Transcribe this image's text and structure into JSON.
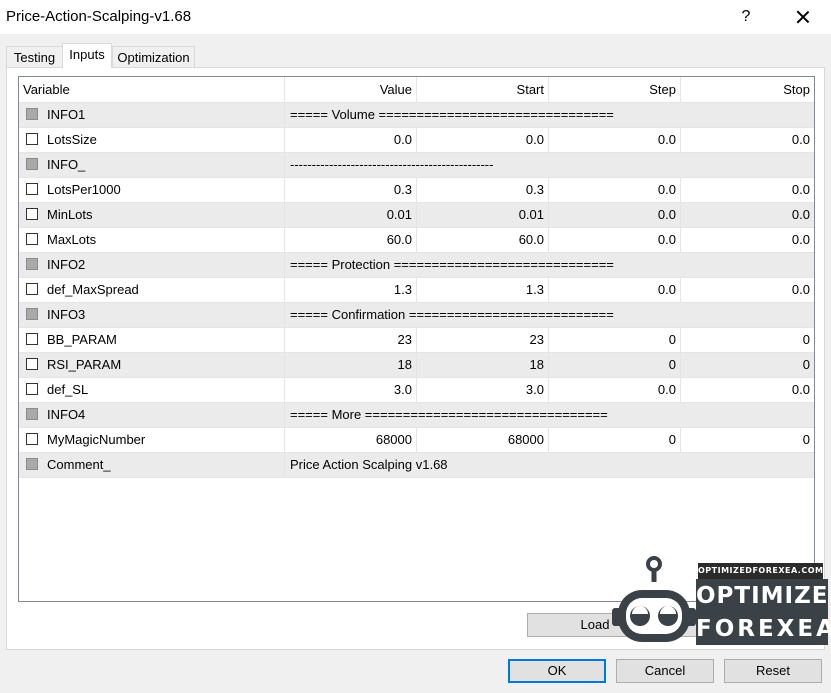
{
  "window": {
    "title": "Price-Action-Scalping-v1.68",
    "help_label": "?"
  },
  "tabs": [
    {
      "label": "Testing",
      "active": false
    },
    {
      "label": "Inputs",
      "active": true
    },
    {
      "label": "Optimization",
      "active": false
    }
  ],
  "grid": {
    "columns": [
      "Variable",
      "Value",
      "Start",
      "Step",
      "Stop"
    ],
    "rows": [
      {
        "name": "INFO1",
        "kind": "info",
        "text": "===== Volume ==============================="
      },
      {
        "name": "LotsSize",
        "kind": "param",
        "value": "0.0",
        "start": "0.0",
        "step": "0.0",
        "stop": "0.0"
      },
      {
        "name": "INFO_",
        "kind": "info",
        "text": "-----------------------------------------------"
      },
      {
        "name": "LotsPer1000",
        "kind": "param",
        "value": "0.3",
        "start": "0.3",
        "step": "0.0",
        "stop": "0.0"
      },
      {
        "name": "MinLots",
        "kind": "param",
        "value": "0.01",
        "start": "0.01",
        "step": "0.0",
        "stop": "0.0"
      },
      {
        "name": "MaxLots",
        "kind": "param",
        "value": "60.0",
        "start": "60.0",
        "step": "0.0",
        "stop": "0.0"
      },
      {
        "name": "INFO2",
        "kind": "info",
        "text": "===== Protection ============================="
      },
      {
        "name": "def_MaxSpread",
        "kind": "param",
        "value": "1.3",
        "start": "1.3",
        "step": "0.0",
        "stop": "0.0"
      },
      {
        "name": "INFO3",
        "kind": "info",
        "text": "===== Confirmation ==========================="
      },
      {
        "name": "BB_PARAM",
        "kind": "param",
        "value": "23",
        "start": "23",
        "step": "0",
        "stop": "0"
      },
      {
        "name": "RSI_PARAM",
        "kind": "param",
        "value": "18",
        "start": "18",
        "step": "0",
        "stop": "0"
      },
      {
        "name": "def_SL",
        "kind": "param",
        "value": "3.0",
        "start": "3.0",
        "step": "0.0",
        "stop": "0.0"
      },
      {
        "name": "INFO4",
        "kind": "info",
        "text": "===== More ================================"
      },
      {
        "name": "MyMagicNumber",
        "kind": "param",
        "value": "68000",
        "start": "68000",
        "step": "0",
        "stop": "0"
      },
      {
        "name": "Comment_",
        "kind": "info",
        "text": "Price Action Scalping v1.68"
      }
    ]
  },
  "buttons": {
    "load": "Load",
    "ok": "OK",
    "cancel": "Cancel",
    "reset": "Reset"
  },
  "watermark": {
    "url": "OPTIMIZEDFOREXEA.COM",
    "line1": "OPTIMIZED",
    "line2": "FOREXEA"
  },
  "colors": {
    "accent": "#0078d7",
    "row_alt": "#ebebeb",
    "disabled_checkbox": "#a9a9a9"
  }
}
